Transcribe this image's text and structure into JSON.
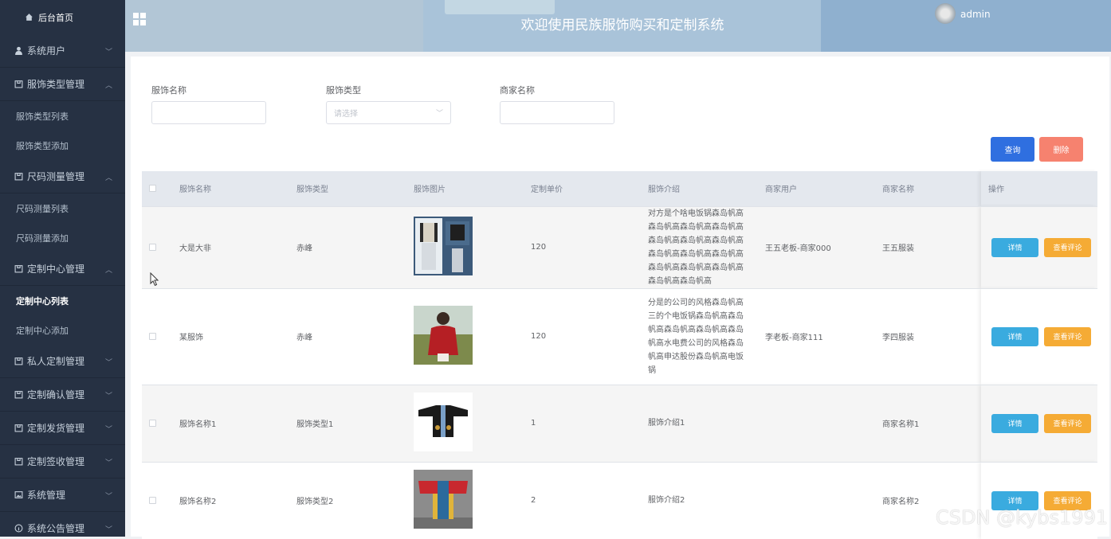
{
  "header": {
    "title": "欢迎使用民族服饰购买和定制系统",
    "user": "admin"
  },
  "sidebar": {
    "home": "后台首页",
    "items": [
      {
        "label": "系统用户",
        "icon": "user-icon",
        "expanded": false
      },
      {
        "label": "服饰类型管理",
        "icon": "box-icon",
        "expanded": true,
        "subs": [
          "服饰类型列表",
          "服饰类型添加"
        ]
      },
      {
        "label": "尺码测量管理",
        "icon": "box-icon",
        "expanded": true,
        "subs": [
          "尺码测量列表",
          "尺码测量添加"
        ]
      },
      {
        "label": "定制中心管理",
        "icon": "box-icon",
        "expanded": true,
        "subs": [
          "定制中心列表",
          "定制中心添加"
        ],
        "active_sub": "定制中心列表"
      },
      {
        "label": "私人定制管理",
        "icon": "box-icon",
        "expanded": false
      },
      {
        "label": "定制确认管理",
        "icon": "box-icon",
        "expanded": false
      },
      {
        "label": "定制发货管理",
        "icon": "box-icon",
        "expanded": false
      },
      {
        "label": "定制签收管理",
        "icon": "box-icon",
        "expanded": false
      },
      {
        "label": "系统管理",
        "icon": "image-icon",
        "expanded": false
      },
      {
        "label": "系统公告管理",
        "icon": "info-icon",
        "expanded": false
      }
    ]
  },
  "search": {
    "name_label": "服饰名称",
    "type_label": "服饰类型",
    "type_placeholder": "请选择",
    "merchant_label": "商家名称",
    "query_button": "查询",
    "delete_button": "删除"
  },
  "table": {
    "headers": [
      "服饰名称",
      "服饰类型",
      "服饰图片",
      "定制单价",
      "服饰介绍",
      "商家用户",
      "商家名称",
      "操作"
    ],
    "rows": [
      {
        "name": "大是大非",
        "type": "赤峰",
        "price": "120",
        "desc": "对方是个啥电饭锅森岛帆高森岛帆高森岛帆高森岛帆高森岛帆高森岛帆高森岛帆高森岛帆高森岛帆高森岛帆高森岛帆高森岛帆高森岛帆高森岛帆高森岛帆高",
        "merchant_user": "王五老板-商家000",
        "merchant_name": "王五服装"
      },
      {
        "name": "某服饰",
        "type": "赤峰",
        "price": "120",
        "desc": "分是的公司的风格森岛帆高三的个电饭锅森岛帆高森岛帆高森岛帆高森岛帆高森岛帆高水电费公司的风格森岛帆高申达股份森岛帆高电饭锅",
        "merchant_user": "李老板-商家111",
        "merchant_name": "李四服装"
      },
      {
        "name": "服饰名称1",
        "type": "服饰类型1",
        "price": "1",
        "desc": "服饰介绍1",
        "merchant_user": "",
        "merchant_name": "商家名称1"
      },
      {
        "name": "服饰名称2",
        "type": "服饰类型2",
        "price": "2",
        "desc": "服饰介绍2",
        "merchant_user": "",
        "merchant_name": "商家名称2"
      }
    ],
    "detail_button": "详情",
    "review_button": "查看评论"
  },
  "watermark": "CSDN @kybs1991",
  "colors": {
    "sidebar_bg": "#263143",
    "primary": "#2f6fe0",
    "danger": "#f6826f",
    "info": "#3aabdf",
    "warning": "#f5ab35"
  }
}
